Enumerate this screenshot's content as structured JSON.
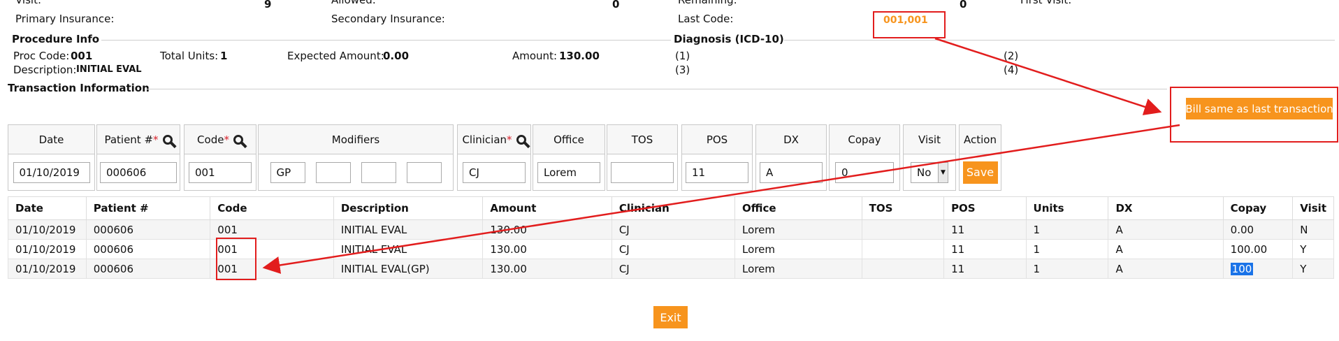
{
  "header": {
    "visit_label": "Visit:",
    "visit_value": "9",
    "allowed_label": "Allowed:",
    "allowed_value": "0",
    "remaining_label": "Remaining:",
    "remaining_value": "0",
    "first_visit_label": "First Visit:",
    "primary_insurance_label": "Primary Insurance:",
    "secondary_insurance_label": "Secondary Insurance:",
    "last_code_label": "Last Code:",
    "last_code_value": "001,001"
  },
  "procedure_info": {
    "title": "Procedure Info",
    "proc_code_label": "Proc Code:",
    "proc_code_value": "001",
    "total_units_label": "Total Units:",
    "total_units_value": "1",
    "expected_amount_label": "Expected Amount:",
    "expected_amount_value": "0.00",
    "amount_label": "Amount:",
    "amount_value": "130.00",
    "description_label": "Description:",
    "description_value": "INITIAL EVAL"
  },
  "diagnosis": {
    "title": "Diagnosis (ICD-10)",
    "d1": "(1)",
    "d2": "(2)",
    "d3": "(3)",
    "d4": "(4)"
  },
  "transaction_info": {
    "title": "Transaction Information"
  },
  "bill_same_button": "Bill same as last transaction",
  "entry": {
    "headers": {
      "date": "Date",
      "patient": "Patient #",
      "code": "Code",
      "modifiers": "Modifiers",
      "clinician": "Clinician",
      "office": "Office",
      "tos": "TOS",
      "pos": "POS",
      "dx": "DX",
      "copay": "Copay",
      "visit": "Visit",
      "action": "Action"
    },
    "required_mark": "*",
    "values": {
      "date": "01/10/2019",
      "patient": "000606",
      "code": "001",
      "mod1": "GP",
      "mod2": "",
      "mod3": "",
      "mod4": "",
      "clinician": "CJ",
      "office": "Lorem",
      "tos": "",
      "pos": "11",
      "dx": "A",
      "copay": "0",
      "visit": "No"
    },
    "save_label": "Save"
  },
  "table": {
    "columns": [
      "Date",
      "Patient #",
      "Code",
      "Description",
      "Amount",
      "Clinician",
      "Office",
      "TOS",
      "POS",
      "Units",
      "DX",
      "Copay",
      "Visit"
    ],
    "rows": [
      [
        "01/10/2019",
        "000606",
        "001",
        "INITIAL EVAL",
        "130.00",
        "CJ",
        "Lorem",
        "",
        "11",
        "1",
        "A",
        "0.00",
        "N"
      ],
      [
        "01/10/2019",
        "000606",
        "001",
        "INITIAL EVAL",
        "130.00",
        "CJ",
        "Lorem",
        "",
        "11",
        "1",
        "A",
        "100.00",
        "Y"
      ],
      [
        "01/10/2019",
        "000606",
        "001",
        "INITIAL EVAL(GP)",
        "130.00",
        "CJ",
        "Lorem",
        "",
        "11",
        "1",
        "A",
        "100",
        "Y"
      ]
    ]
  },
  "exit_label": "Exit",
  "colors": {
    "accent": "#f7941d",
    "annotation": "#e21d1d",
    "selection": "#1a73e8"
  }
}
